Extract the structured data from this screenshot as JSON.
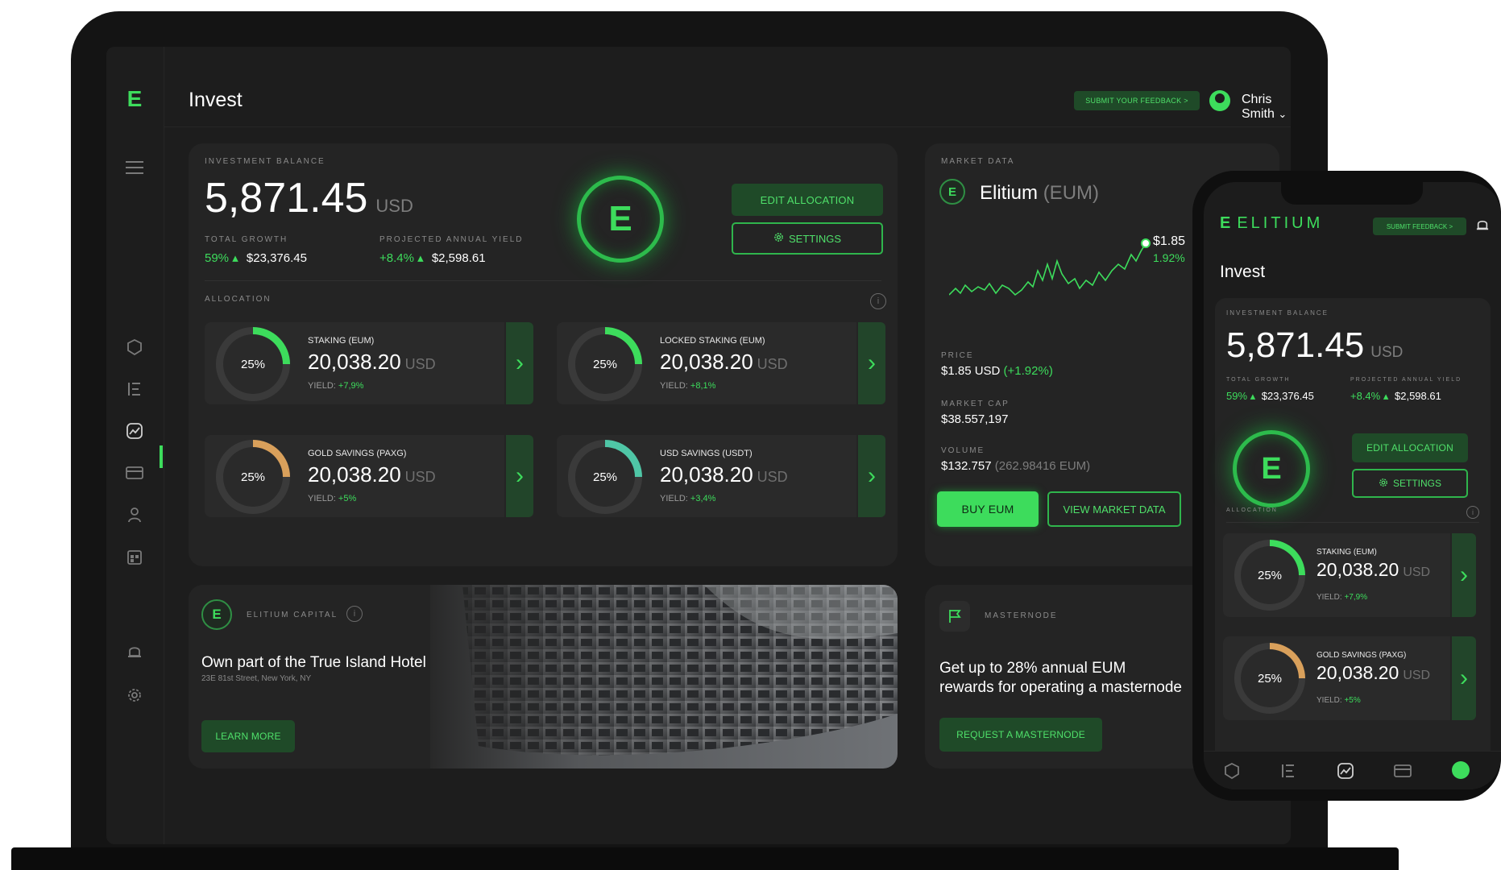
{
  "app": {
    "page_title": "Invest",
    "feedback_button": "SUBMIT YOUR FEEDBACK >",
    "user_name": "Chris Smith",
    "user_chevron": "⌄",
    "logo_glyph": "Ε"
  },
  "sidebar_icons": [
    "menu-icon",
    "shield-icon",
    "invest-icon",
    "chart-icon",
    "card-icon",
    "user-icon",
    "calendar-icon",
    "bell-icon",
    "gear-icon"
  ],
  "balance": {
    "label": "INVESTMENT BALANCE",
    "amount": "5,871.45",
    "currency": "USD",
    "total_growth_label": "TOTAL GROWTH",
    "total_growth_pct": "59% ▴",
    "total_growth_value": "$23,376.45",
    "projected_label": "PROJECTED ANNUAL YIELD",
    "projected_pct": "+8.4% ▴",
    "projected_value": "$2,598.61",
    "edit_allocation": "EDIT ALLOCATION",
    "settings": "SETTINGS",
    "allocation_label": "ALLOCATION"
  },
  "allocations": [
    {
      "name": "STAKING (EUM)",
      "pct": "25%",
      "amount": "20,038.20",
      "currency": "USD",
      "yield_label": "YIELD:",
      "yield": "+7,9%",
      "color": "#3ddc5c",
      "fill": 0.25
    },
    {
      "name": "LOCKED STAKING (EUM)",
      "pct": "25%",
      "amount": "20,038.20",
      "currency": "USD",
      "yield_label": "YIELD:",
      "yield": "+8,1%",
      "color": "#3ddc5c",
      "fill": 0.25
    },
    {
      "name": "GOLD SAVINGS (PAXG)",
      "pct": "25%",
      "amount": "20,038.20",
      "currency": "USD",
      "yield_label": "YIELD:",
      "yield": "+5%",
      "color": "#d9a05b",
      "fill": 0.25
    },
    {
      "name": "USD SAVINGS (USDT)",
      "pct": "25%",
      "amount": "20,038.20",
      "currency": "USD",
      "yield_label": "YIELD:",
      "yield": "+3,4%",
      "color": "#4fc6a6",
      "fill": 0.25
    }
  ],
  "market": {
    "label": "MARKET DATA",
    "coin_name": "Elitium",
    "coin_ticker": "(EUM)",
    "chart_price": "$1.85",
    "chart_change": "1.92%",
    "price_label": "PRICE",
    "price": "$1.85 USD",
    "price_change": "(+1.92%)",
    "cap_label": "MARKET CAP",
    "cap": "$38.557,197",
    "volume_label": "VOLUME",
    "volume": "$132.757",
    "volume_eum": "(262.98416 EUM)",
    "buy_button": "BUY EUM",
    "view_button": "VIEW MARKET DATA"
  },
  "capital": {
    "label": "ELITIUM CAPITAL",
    "title": "Own part of the True Island Hotel",
    "address": "23E 81st Street, New York, NY",
    "button": "LEARN MORE"
  },
  "masternode": {
    "label": "MASTERNODE",
    "text_line1": "Get up to 28% annual EUM",
    "text_line2": "rewards for operating a masternode",
    "button": "REQUEST A MASTERNODE"
  },
  "phone": {
    "brand": "ELITIUM",
    "feedback_button": "SUBMIT FEEDBACK >",
    "title": "Invest",
    "balance_label": "INVESTMENT BALANCE",
    "amount": "5,871.45",
    "currency": "USD",
    "total_growth_label": "TOTAL GROWTH",
    "total_growth_pct": "59% ▴",
    "total_growth_value": "$23,376.45",
    "projected_label": "PROJECTED ANNUAL YIELD",
    "projected_pct": "+8.4% ▴",
    "projected_value": "$2,598.61",
    "edit_allocation": "EDIT ALLOCATION",
    "settings": "SETTINGS",
    "allocation_label": "ALLOCATION"
  }
}
